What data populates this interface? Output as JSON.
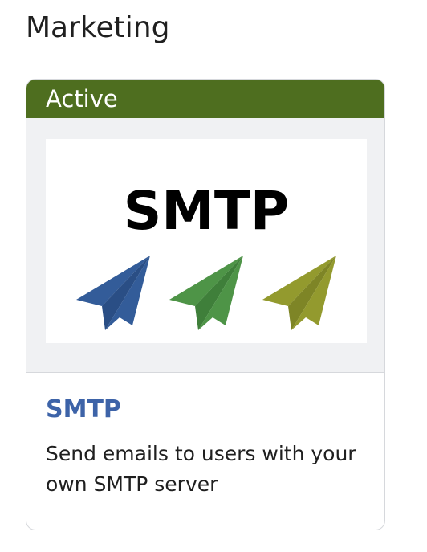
{
  "section": {
    "title": "Marketing"
  },
  "card": {
    "status": "Active",
    "logo_text": "SMTP",
    "title": "SMTP",
    "description": "Send emails to users with your own SMTP server",
    "colors": {
      "status_bg": "#4e6e1f",
      "title": "#3d63a8",
      "plane_blue": "#335c99",
      "plane_green": "#4e9447",
      "plane_olive": "#939a2e"
    },
    "icons": [
      "paper-plane-icon",
      "paper-plane-icon",
      "paper-plane-icon"
    ]
  }
}
